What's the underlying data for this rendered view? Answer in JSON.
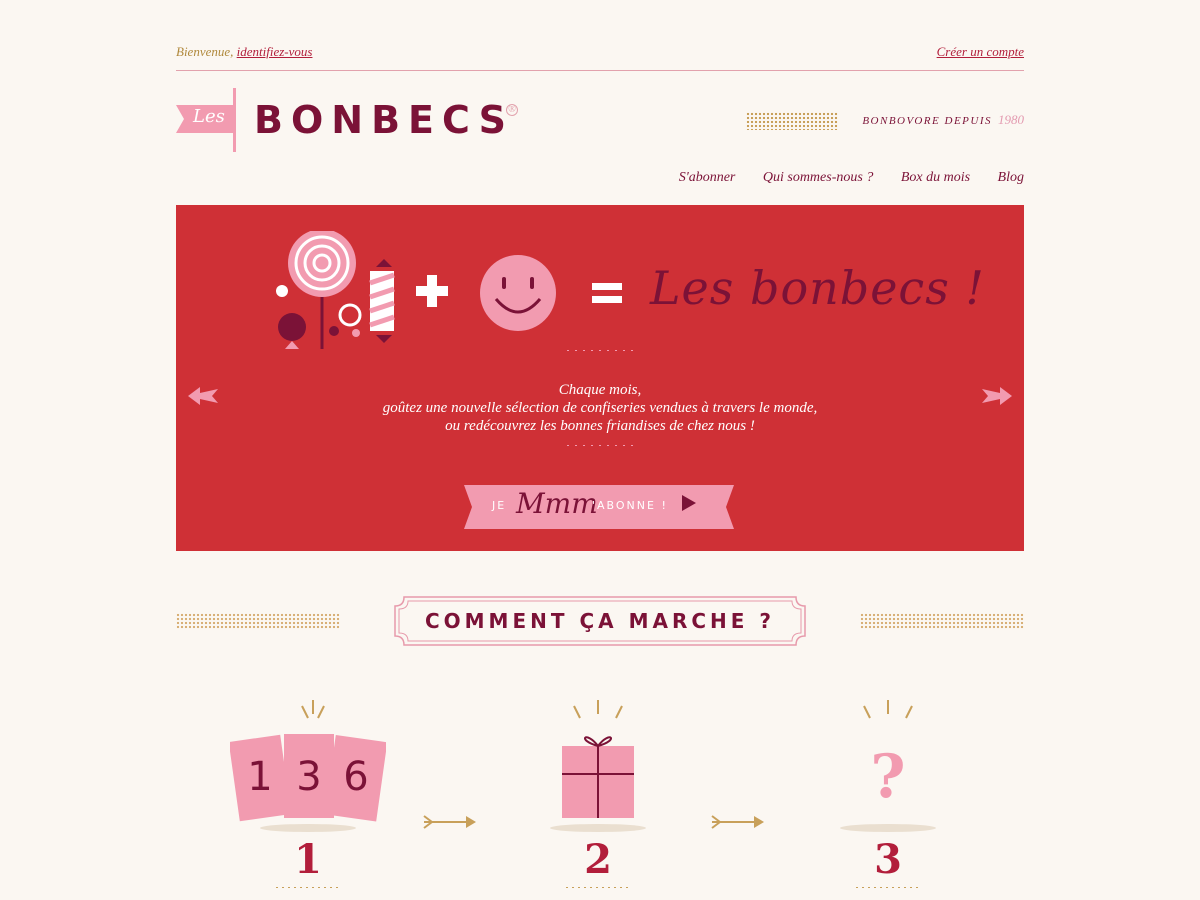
{
  "topbar": {
    "welcome_text": "Bienvenue,",
    "login_link": "identifiez-vous",
    "create_account": "Créer un compte"
  },
  "header": {
    "flag_text": "Les",
    "brand": "BONBECS",
    "registered": "®",
    "since_label": "BONBOVORE DEPUIS",
    "since_year": "1980"
  },
  "nav": {
    "items": [
      "S'abonner",
      "Qui sommes-nous ?",
      "Box du mois",
      "Blog"
    ]
  },
  "hero": {
    "title": "Les bonbecs !",
    "line1": "Chaque mois,",
    "line2": "goûtez une nouvelle sélection de confiseries vendues à travers le monde,",
    "line3": "ou redécouvrez les bonnes friandises de chez nous !",
    "cta_je": "JE",
    "cta_mmm": "Mmm",
    "cta_rest": "'ABONNE !"
  },
  "section": {
    "title": "COMMENT ÇA MARCHE ?"
  },
  "steps": [
    {
      "number": "1",
      "icon": "tickets-icon",
      "tickets": [
        "1",
        "3",
        "6"
      ]
    },
    {
      "number": "2",
      "icon": "gift-box-icon"
    },
    {
      "number": "3",
      "icon": "question-mark-icon",
      "symbol": "?"
    }
  ],
  "colors": {
    "background": "#fbf7f2",
    "hero_red": "#cf3036",
    "brand_burgundy": "#7b1237",
    "pink": "#f29bb0",
    "gold": "#c8a05a"
  }
}
